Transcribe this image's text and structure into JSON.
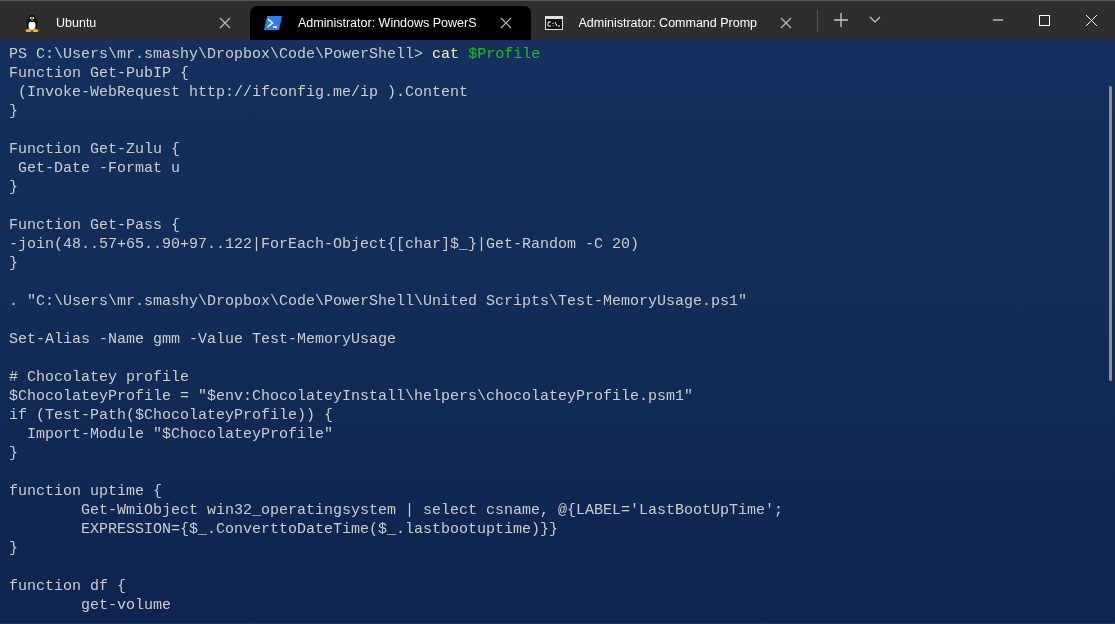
{
  "tabs": [
    {
      "title": "Ubuntu",
      "kind": "linux",
      "selected": false
    },
    {
      "title": "Administrator: Windows PowerS",
      "kind": "powershell",
      "selected": true
    },
    {
      "title": "Administrator: Command Promp",
      "kind": "cmd",
      "selected": false
    }
  ],
  "terminal": {
    "prompt": {
      "path": "PS C:\\Users\\mr.smashy\\Dropbox\\Code\\PowerShell>",
      "command": "cat",
      "argument": "$Profile"
    },
    "blocks": [
      [
        "Function Get-PubIP {",
        " (Invoke-WebRequest http://ifconfig.me/ip ).Content",
        "}"
      ],
      [
        "Function Get-Zulu {",
        " Get-Date -Format u",
        "}"
      ],
      [
        "Function Get-Pass {",
        "-join(48..57+65..90+97..122|ForEach-Object{[char]$_}|Get-Random -C 20)",
        "}"
      ],
      [
        ". \"C:\\Users\\mr.smashy\\Dropbox\\Code\\PowerShell\\United Scripts\\Test-MemoryUsage.ps1\""
      ],
      [
        "Set-Alias -Name gmm -Value Test-MemoryUsage"
      ],
      [
        "# Chocolatey profile",
        "$ChocolateyProfile = \"$env:ChocolateyInstall\\helpers\\chocolateyProfile.psm1\"",
        "if (Test-Path($ChocolateyProfile)) {",
        "  Import-Module \"$ChocolateyProfile\"",
        "}"
      ],
      [
        "function uptime {",
        "        Get-WmiObject win32_operatingsystem | select csname, @{LABEL='LastBootUpTime';",
        "        EXPRESSION={$_.ConverttoDateTime($_.lastbootuptime)}}",
        "}"
      ],
      [
        "function df {",
        "        get-volume"
      ]
    ]
  }
}
